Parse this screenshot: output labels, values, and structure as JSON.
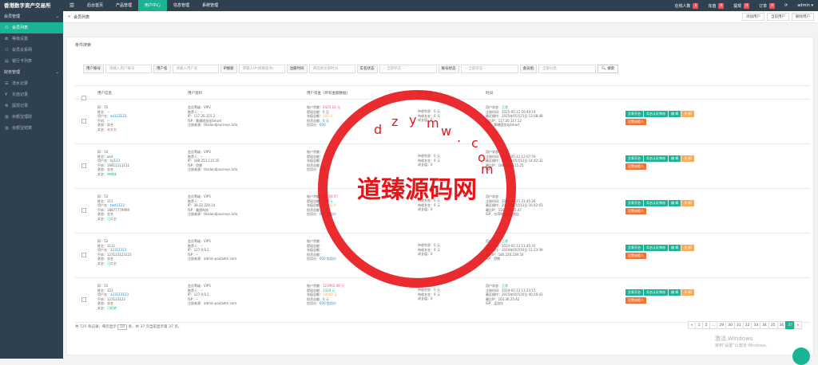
{
  "app": {
    "brand": "香港数字资产交易所",
    "hamburger": "☰"
  },
  "nav": {
    "tabs": [
      "后台首页",
      "产品管理",
      "用户中心",
      "信息管理",
      "系统管理"
    ],
    "active": 2
  },
  "topright": [
    {
      "label": "在线人数",
      "badge": "1",
      "color": "#ed5565"
    },
    {
      "label": "充值",
      "badge": "0",
      "color": "#ed5565"
    },
    {
      "label": "提现",
      "badge": "0",
      "color": "#ed5565"
    },
    {
      "label": "订单",
      "badge": "0",
      "color": "#ed5565"
    },
    {
      "label": "⟳",
      "badge": "",
      "color": ""
    },
    {
      "label": "admin ▾",
      "badge": "",
      "color": ""
    }
  ],
  "sidebar": [
    {
      "type": "group",
      "label": "会员管理",
      "caret": "⌄"
    },
    {
      "type": "item",
      "label": "会员列表",
      "icon": "user-icon",
      "glyph": "⚇",
      "active": true
    },
    {
      "type": "item",
      "label": "等级设置",
      "icon": "settings-icon",
      "glyph": "✿"
    },
    {
      "type": "item",
      "label": "会员关系网",
      "icon": "users-icon",
      "glyph": "⚇"
    },
    {
      "type": "item",
      "label": "银行卡列表",
      "icon": "card-icon",
      "glyph": "▤"
    },
    {
      "type": "group",
      "label": "财务管理",
      "caret": "⌄"
    },
    {
      "type": "item",
      "label": "流水记录",
      "icon": "list-icon",
      "glyph": "☰"
    },
    {
      "type": "item",
      "label": "充值记录",
      "icon": "rmb-icon",
      "glyph": "¥"
    },
    {
      "type": "item",
      "label": "提现记录",
      "icon": "gear-icon",
      "glyph": "⚙"
    },
    {
      "type": "item",
      "label": "余额宝理财",
      "icon": "chart-icon",
      "glyph": "▥"
    },
    {
      "type": "item",
      "label": "余额宝结算",
      "icon": "chart-icon",
      "glyph": "▥"
    }
  ],
  "breadcrumb": {
    "home": "«",
    "current": "会员列表",
    "next": "»"
  },
  "crumb_actions": [
    "添加用户",
    "当前用户",
    "删除用户"
  ],
  "panel_title": "条件搜索",
  "filters": [
    {
      "label": "用户账号",
      "placeholder": "请输入用户账号",
      "w": 58
    },
    {
      "label": "用户名",
      "placeholder": "请输入用户名",
      "w": 58
    },
    {
      "label": "IP搜索",
      "placeholder": "请输入IP(模糊查询)",
      "w": 58
    },
    {
      "label": "注册时间",
      "placeholder": "请选择注册时间",
      "w": 58
    },
    {
      "label": "实名状态",
      "placeholder": "-- 全部状态 --",
      "w": 72
    },
    {
      "label": "账号状态",
      "placeholder": "-- 全部状态 --",
      "w": 72
    },
    {
      "label": "会员组",
      "placeholder": "全部分类",
      "w": 72
    }
  ],
  "search_label": "搜索",
  "headers": [
    "用户信息",
    "用户资料",
    "用户资金（所有金额数据）",
    "用户存量",
    "时间"
  ],
  "rows": [
    {
      "info": [
        [
          "ID：",
          "55",
          ""
        ],
        [
          "姓名：",
          "--",
          ""
        ],
        [
          "用户名：",
          "aa123123",
          "blue"
        ],
        [
          "手机：",
          "--",
          ""
        ],
        [
          "状态：",
          "实名",
          ""
        ],
        [
          "实名：",
          "未实名",
          "red"
        ]
      ],
      "profile": [
        [
          "会员等级：",
          "VIP2",
          ""
        ],
        [
          "推荐人：",
          "--",
          ""
        ],
        [
          "IP：",
          "117.20.115.2",
          ""
        ],
        [
          "ISP：",
          "黄埔国金站Smart",
          ""
        ],
        [
          "注册来源：",
          "thailandjourneys.info",
          ""
        ]
      ],
      "funds": [
        [
          "账户余额：",
          "2425.10 元",
          "red"
        ],
        [
          "提现总额：",
          "0 元",
          ""
        ],
        [
          "充值总额：",
          "100 元",
          "orange"
        ],
        [
          "投资总额：",
          "0 元",
          "blue"
        ],
        [
          "信用分：",
          "650",
          "blue"
        ]
      ],
      "stock": [
        [
          "待收利息：",
          "0 元",
          ""
        ],
        [
          "待收本金：",
          "0 元",
          ""
        ],
        [
          "成长值：",
          "0",
          ""
        ]
      ],
      "time": [
        [
          "用户状态：",
          "正常",
          "green"
        ],
        [
          "注册时间：",
          "2025-05-12 16:49:19",
          ""
        ],
        [
          "最近操作：",
          "2025年05月21日 13:08:48",
          ""
        ],
        [
          "最后IP：",
          "117.20.117.12",
          ""
        ],
        [
          "ISP：",
          "黄埔国金站Smart",
          ""
        ]
      ]
    },
    {
      "info": [
        [
          "ID：",
          "54",
          ""
        ],
        [
          "姓名：",
          "asd",
          ""
        ],
        [
          "用户名：",
          "ky123",
          "blue"
        ],
        [
          "手机：",
          "16811111111",
          ""
        ],
        [
          "状态：",
          "实名",
          ""
        ],
        [
          "实名：",
          "待审核",
          "green"
        ]
      ],
      "profile": [
        [
          "会员等级：",
          "VIP0",
          ""
        ],
        [
          "推荐人：",
          "--",
          ""
        ],
        [
          "IP：",
          "188.253.115.25",
          ""
        ],
        [
          "ISP：",
          "伊朗",
          ""
        ],
        [
          "注册来源：",
          "thailandjourneys.info",
          ""
        ]
      ],
      "funds": [
        [
          "账户余额：",
          "",
          "red"
        ],
        [
          "提现总额：",
          "",
          ""
        ],
        [
          "充值总额：",
          "",
          "orange"
        ],
        [
          "投资总额：",
          "",
          "blue"
        ],
        [
          "信用分：",
          "650",
          "blue"
        ]
      ],
      "stock": [
        [
          "待收利息：",
          "0 元",
          ""
        ],
        [
          "待收本金：",
          "0 元",
          ""
        ],
        [
          "成长值：",
          "0",
          ""
        ]
      ],
      "time": [
        [
          "用户状态：",
          "正常",
          "green"
        ],
        [
          "注册时间：",
          "2025-05-12 12:07:59",
          ""
        ],
        [
          "最近操作：",
          "2025年05月12日 14:42:32",
          ""
        ],
        [
          "最后IP：",
          "188.253.115.25",
          ""
        ],
        [
          "ISP：",
          "",
          ""
        ]
      ]
    },
    {
      "info": [
        [
          "ID：",
          "53",
          ""
        ],
        [
          "姓名：",
          "111",
          ""
        ],
        [
          "用户名：",
          "test1122",
          "blue"
        ],
        [
          "手机：",
          "18877779999",
          ""
        ],
        [
          "状态：",
          "实名",
          ""
        ],
        [
          "实名：",
          "已实名",
          "green"
        ]
      ],
      "profile": [
        [
          "会员等级：",
          "VIP5",
          ""
        ],
        [
          "推荐人：",
          "--",
          ""
        ],
        [
          "IP：",
          "38.22.229.14",
          ""
        ],
        [
          "ISP：",
          "美国科技",
          ""
        ],
        [
          "注册来源：",
          "thailandjourneys.info",
          ""
        ]
      ],
      "funds": [
        [
          "账户余额：",
          "21258.97",
          "red"
        ],
        [
          "提现总额：",
          "100 元",
          "green"
        ],
        [
          "充值总额：",
          "21401.9",
          "orange"
        ],
        [
          "投资总额：",
          "0 元",
          "blue"
        ],
        [
          "信用分：",
          "650 信用分",
          "blue"
        ]
      ],
      "stock": [
        [
          "待收利息：",
          "0 元",
          ""
        ],
        [
          "待收本金：",
          "0 元",
          ""
        ],
        [
          "成长值：",
          "0",
          ""
        ]
      ],
      "time": [
        [
          "用户状态：",
          "",
          ""
        ],
        [
          "注册时间：",
          "2025-05-11 21:45:26",
          ""
        ],
        [
          "最近操作：",
          "2025年05月12日 16:42:03",
          ""
        ],
        [
          "最后IP：",
          "150.147.45.47",
          ""
        ],
        [
          "ISP：",
          "台湾地区亚太地区",
          ""
        ]
      ]
    },
    {
      "info": [
        [
          "ID：",
          "52",
          ""
        ],
        [
          "姓名：",
          "1111",
          ""
        ],
        [
          "用户名：",
          "12312312",
          "blue"
        ],
        [
          "手机：",
          "1231231231​23",
          ""
        ],
        [
          "状态：",
          "实名",
          ""
        ],
        [
          "实名：",
          "已实名",
          "green"
        ]
      ],
      "profile": [
        [
          "会员等级：",
          "VIP5",
          ""
        ],
        [
          "推荐人：",
          "--",
          ""
        ],
        [
          "IP：",
          "127.0.0.1",
          ""
        ],
        [
          "ISP：",
          "--",
          ""
        ],
        [
          "注册来源：",
          "admin.postadm.com",
          ""
        ]
      ],
      "funds": [
        [
          "账户余额：",
          "",
          "red"
        ],
        [
          "提现总额：",
          "",
          ""
        ],
        [
          "充值总额：",
          "",
          "orange"
        ],
        [
          "投资总额：",
          "",
          ""
        ],
        [
          "信用分：",
          "650 信用分",
          "blue"
        ]
      ],
      "stock": [
        [
          "待收利息：",
          "0 元",
          ""
        ],
        [
          "待收本金：",
          "0 元",
          ""
        ],
        [
          "成长值：",
          "0",
          ""
        ]
      ],
      "time": [
        [
          "用户状态：",
          "正常",
          "green"
        ],
        [
          "注册时间：",
          "2024-01-12 11:45:31",
          ""
        ],
        [
          "最近操作：",
          "2024年05月16日 11:23:39",
          ""
        ],
        [
          "最后IP：",
          "180.220.239.50",
          ""
        ],
        [
          "ISP：",
          "伊朗",
          ""
        ]
      ]
    },
    {
      "info": [
        [
          "ID：",
          "51",
          ""
        ],
        [
          "姓名：",
          "123",
          ""
        ],
        [
          "用户名：",
          "123123123",
          "blue"
        ],
        [
          "手机：",
          "123123123",
          ""
        ],
        [
          "状态：",
          "实名",
          ""
        ],
        [
          "实名：",
          "已拒绝",
          "green"
        ]
      ],
      "profile": [
        [
          "会员等级：",
          "VIP5",
          ""
        ],
        [
          "推荐人：",
          "--",
          ""
        ],
        [
          "IP：",
          "127.0.0.1",
          ""
        ],
        [
          "ISP：",
          "--",
          ""
        ],
        [
          "注册来源：",
          "admin.postadm.com",
          ""
        ]
      ],
      "funds": [
        [
          "账户余额：",
          "123992.49 元",
          "red"
        ],
        [
          "提现总额：",
          "1420 元",
          "green"
        ],
        [
          "充值总额：",
          "10000 元",
          "orange"
        ],
        [
          "投资总额：",
          "0 元",
          "blue"
        ],
        [
          "信用分：",
          "650 信用分",
          "blue"
        ]
      ],
      "stock": [
        [
          "待收利息：",
          "0 元",
          ""
        ],
        [
          "待收本金：",
          "0 元",
          ""
        ],
        [
          "成长值：",
          "0",
          ""
        ]
      ],
      "time": [
        [
          "用户状态：",
          "正常",
          "green"
        ],
        [
          "注册时间：",
          "2024-01-12 11:23:15",
          ""
        ],
        [
          "最近操作：",
          "2025年05月20日 00:16:43",
          ""
        ],
        [
          "最后IP：",
          "103.36.25.42",
          ""
        ],
        [
          "ISP：",
          "孟加拉",
          ""
        ]
      ]
    }
  ],
  "row_actions": [
    {
      "label": "交易开启",
      "color": "g"
    },
    {
      "label": "实名认证审核",
      "color": "g"
    },
    {
      "label": "编 辑",
      "color": "g"
    },
    {
      "label": "关 闭",
      "color": "y"
    },
    {
      "label": "设置成假人",
      "color": "o"
    }
  ],
  "footer": {
    "prefix": "共 725 条记录，每页显示",
    "perpage": "10",
    "suffix": "条，共 37 页当前显示第 37 页。"
  },
  "pager": [
    "«",
    "1",
    "2",
    "...",
    "29",
    "30",
    "31",
    "32",
    "33",
    "34",
    "35",
    "36",
    "37",
    "»"
  ],
  "pager_active": "37",
  "watermark": {
    "center": "道臻源码网",
    "letters": [
      "d",
      "z",
      "y",
      "m",
      "w",
      ".",
      "c",
      "o",
      "m"
    ]
  },
  "windows": {
    "line1": "激活 Windows",
    "line2": "转到\"设置\"以激活 Windows。"
  }
}
